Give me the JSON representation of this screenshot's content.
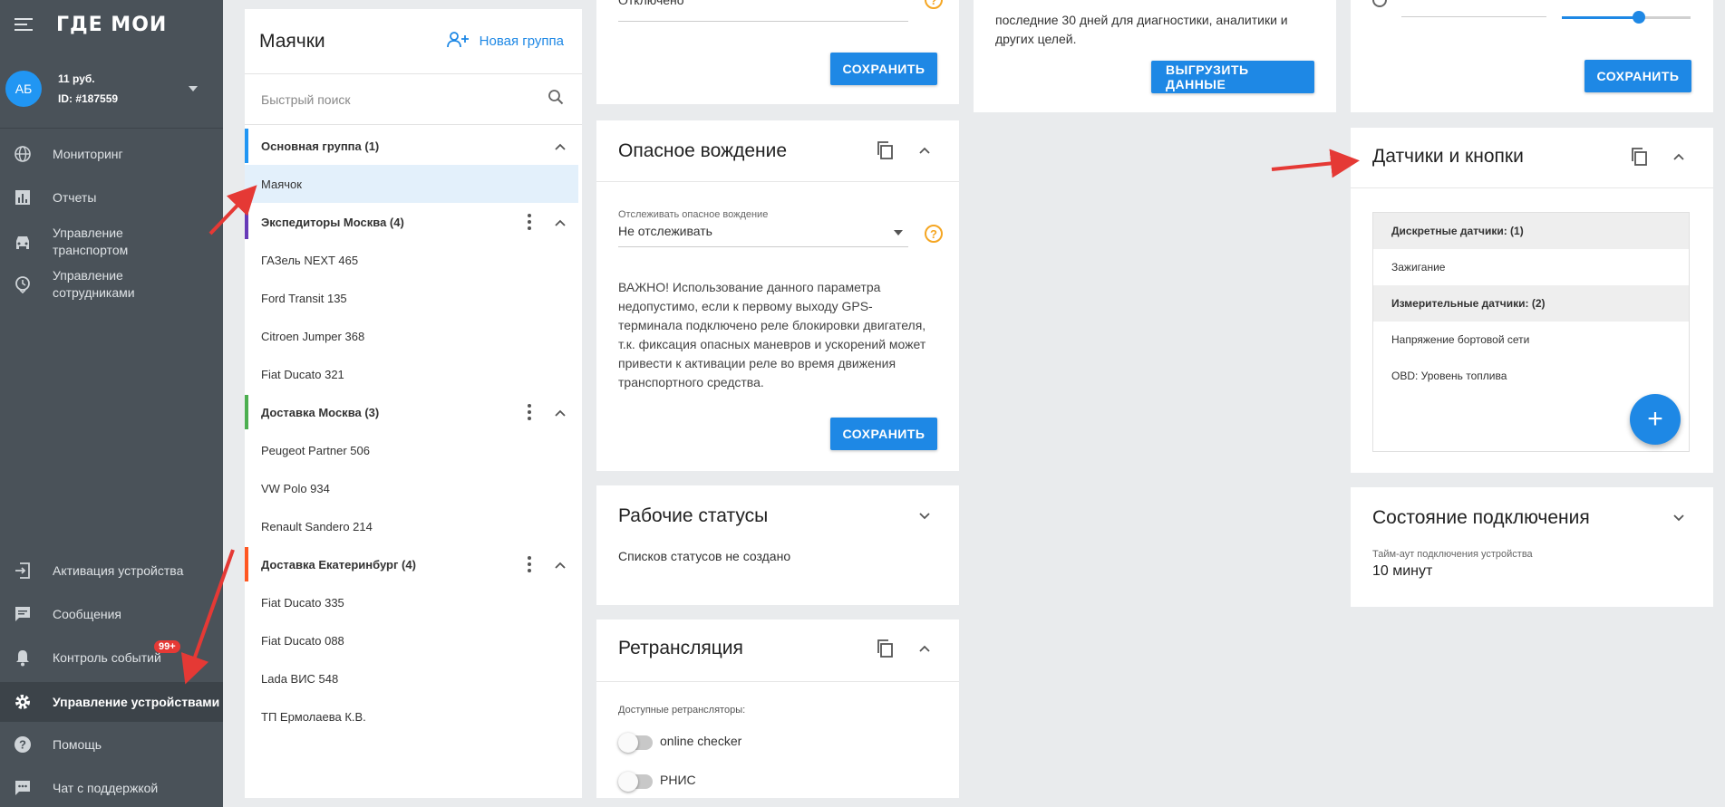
{
  "app": {
    "logo": "ГДЕ МОИ"
  },
  "account": {
    "initials": "АБ",
    "balance": "11 руб.",
    "id": "ID: #187559"
  },
  "nav": {
    "monitoring": "Мониторинг",
    "reports": "Отчеты",
    "transport": "Управление транспортом",
    "staff": "Управление сотрудниками",
    "activation": "Активация устройства",
    "messages": "Сообщения",
    "events": "Контроль событий",
    "events_badge": "99+",
    "devices": "Управление устройствами",
    "help": "Помощь",
    "support": "Чат с поддержкой"
  },
  "beacons": {
    "title": "Маячки",
    "new_group": "Новая группа",
    "search_placeholder": "Быстрый поиск",
    "groups": [
      {
        "name": "Основная группа (1)",
        "color": "#2196f3",
        "items": [
          "Маячок"
        ]
      },
      {
        "name": "Экспедиторы Москва (4)",
        "color": "#673ab7",
        "items": [
          "ГАЗель NEXT 465",
          "Ford Transit 135",
          "Citroen Jumper 368",
          "Fiat Ducato 321"
        ]
      },
      {
        "name": "Доставка Москва (3)",
        "color": "#4caf50",
        "items": [
          "Peugeot Partner 506",
          "VW Polo 934",
          "Renault Sandero 214"
        ]
      },
      {
        "name": "Доставка Екатеринбург (4)",
        "color": "#ff5722",
        "items": [
          "Fiat Ducato 335",
          "Fiat Ducato 088",
          "Lada ВИС 548",
          "ТП Ермолаева К.В."
        ]
      }
    ]
  },
  "top_card": {
    "field_value": "Отключено",
    "save": "СОХРАНИТЬ"
  },
  "dangerous": {
    "title": "Опасное вождение",
    "field_label": "Отслеживать опасное вождение",
    "field_value": "Не отслеживать",
    "warning": "ВАЖНО! Использование данного параметра недопустимо, если к первому выходу GPS-терминала подключено реле блокировки двигателя, т.к. фиксация опасных маневров и ускорений может привести к активации реле во время движения транспортного средства.",
    "save": "СОХРАНИТЬ"
  },
  "statuses": {
    "title": "Рабочие статусы",
    "empty": "Списков статусов не создано"
  },
  "retrans": {
    "title": "Ретрансляция",
    "label": "Доступные ретрансляторы:",
    "items": [
      "online checker",
      "РНИС"
    ]
  },
  "export_card": {
    "text": "последние 30 дней для диагностики, аналитики и других целей.",
    "button": "ВЫГРУЗИТЬ ДАННЫЕ"
  },
  "right_top": {
    "save": "СОХРАНИТЬ",
    "slider_level": 0.6
  },
  "sensors": {
    "title": "Датчики и кнопки",
    "discrete_header": "Дискретные датчики: (1)",
    "discrete": [
      "Зажигание"
    ],
    "measure_header": "Измерительные датчики: (2)",
    "measure": [
      "Напряжение бортовой сети",
      "OBD: Уровень топлива"
    ],
    "add": "+"
  },
  "connection": {
    "title": "Состояние подключения",
    "label": "Тайм-аут подключения устройства",
    "value": "10 минут"
  },
  "colors": {
    "accent": "#1e88e5",
    "sidebar": "#4a5259",
    "help": "#f5a623",
    "badge": "#e53935",
    "arrow": "#e53935"
  }
}
